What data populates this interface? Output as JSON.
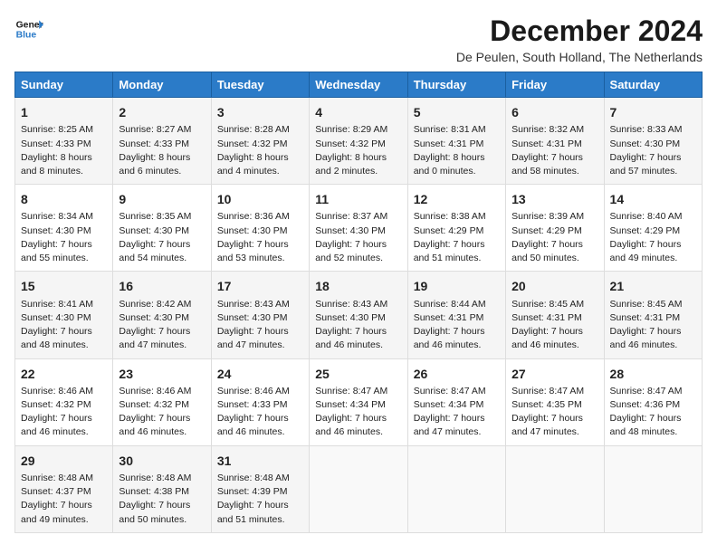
{
  "header": {
    "logo_line1": "General",
    "logo_line2": "Blue",
    "title": "December 2024",
    "subtitle": "De Peulen, South Holland, The Netherlands"
  },
  "columns": [
    "Sunday",
    "Monday",
    "Tuesday",
    "Wednesday",
    "Thursday",
    "Friday",
    "Saturday"
  ],
  "weeks": [
    [
      {
        "day": "1",
        "info": "Sunrise: 8:25 AM\nSunset: 4:33 PM\nDaylight: 8 hours\nand 8 minutes."
      },
      {
        "day": "2",
        "info": "Sunrise: 8:27 AM\nSunset: 4:33 PM\nDaylight: 8 hours\nand 6 minutes."
      },
      {
        "day": "3",
        "info": "Sunrise: 8:28 AM\nSunset: 4:32 PM\nDaylight: 8 hours\nand 4 minutes."
      },
      {
        "day": "4",
        "info": "Sunrise: 8:29 AM\nSunset: 4:32 PM\nDaylight: 8 hours\nand 2 minutes."
      },
      {
        "day": "5",
        "info": "Sunrise: 8:31 AM\nSunset: 4:31 PM\nDaylight: 8 hours\nand 0 minutes."
      },
      {
        "day": "6",
        "info": "Sunrise: 8:32 AM\nSunset: 4:31 PM\nDaylight: 7 hours\nand 58 minutes."
      },
      {
        "day": "7",
        "info": "Sunrise: 8:33 AM\nSunset: 4:30 PM\nDaylight: 7 hours\nand 57 minutes."
      }
    ],
    [
      {
        "day": "8",
        "info": "Sunrise: 8:34 AM\nSunset: 4:30 PM\nDaylight: 7 hours\nand 55 minutes."
      },
      {
        "day": "9",
        "info": "Sunrise: 8:35 AM\nSunset: 4:30 PM\nDaylight: 7 hours\nand 54 minutes."
      },
      {
        "day": "10",
        "info": "Sunrise: 8:36 AM\nSunset: 4:30 PM\nDaylight: 7 hours\nand 53 minutes."
      },
      {
        "day": "11",
        "info": "Sunrise: 8:37 AM\nSunset: 4:30 PM\nDaylight: 7 hours\nand 52 minutes."
      },
      {
        "day": "12",
        "info": "Sunrise: 8:38 AM\nSunset: 4:29 PM\nDaylight: 7 hours\nand 51 minutes."
      },
      {
        "day": "13",
        "info": "Sunrise: 8:39 AM\nSunset: 4:29 PM\nDaylight: 7 hours\nand 50 minutes."
      },
      {
        "day": "14",
        "info": "Sunrise: 8:40 AM\nSunset: 4:29 PM\nDaylight: 7 hours\nand 49 minutes."
      }
    ],
    [
      {
        "day": "15",
        "info": "Sunrise: 8:41 AM\nSunset: 4:30 PM\nDaylight: 7 hours\nand 48 minutes."
      },
      {
        "day": "16",
        "info": "Sunrise: 8:42 AM\nSunset: 4:30 PM\nDaylight: 7 hours\nand 47 minutes."
      },
      {
        "day": "17",
        "info": "Sunrise: 8:43 AM\nSunset: 4:30 PM\nDaylight: 7 hours\nand 47 minutes."
      },
      {
        "day": "18",
        "info": "Sunrise: 8:43 AM\nSunset: 4:30 PM\nDaylight: 7 hours\nand 46 minutes."
      },
      {
        "day": "19",
        "info": "Sunrise: 8:44 AM\nSunset: 4:31 PM\nDaylight: 7 hours\nand 46 minutes."
      },
      {
        "day": "20",
        "info": "Sunrise: 8:45 AM\nSunset: 4:31 PM\nDaylight: 7 hours\nand 46 minutes."
      },
      {
        "day": "21",
        "info": "Sunrise: 8:45 AM\nSunset: 4:31 PM\nDaylight: 7 hours\nand 46 minutes."
      }
    ],
    [
      {
        "day": "22",
        "info": "Sunrise: 8:46 AM\nSunset: 4:32 PM\nDaylight: 7 hours\nand 46 minutes."
      },
      {
        "day": "23",
        "info": "Sunrise: 8:46 AM\nSunset: 4:32 PM\nDaylight: 7 hours\nand 46 minutes."
      },
      {
        "day": "24",
        "info": "Sunrise: 8:46 AM\nSunset: 4:33 PM\nDaylight: 7 hours\nand 46 minutes."
      },
      {
        "day": "25",
        "info": "Sunrise: 8:47 AM\nSunset: 4:34 PM\nDaylight: 7 hours\nand 46 minutes."
      },
      {
        "day": "26",
        "info": "Sunrise: 8:47 AM\nSunset: 4:34 PM\nDaylight: 7 hours\nand 47 minutes."
      },
      {
        "day": "27",
        "info": "Sunrise: 8:47 AM\nSunset: 4:35 PM\nDaylight: 7 hours\nand 47 minutes."
      },
      {
        "day": "28",
        "info": "Sunrise: 8:47 AM\nSunset: 4:36 PM\nDaylight: 7 hours\nand 48 minutes."
      }
    ],
    [
      {
        "day": "29",
        "info": "Sunrise: 8:48 AM\nSunset: 4:37 PM\nDaylight: 7 hours\nand 49 minutes."
      },
      {
        "day": "30",
        "info": "Sunrise: 8:48 AM\nSunset: 4:38 PM\nDaylight: 7 hours\nand 50 minutes."
      },
      {
        "day": "31",
        "info": "Sunrise: 8:48 AM\nSunset: 4:39 PM\nDaylight: 7 hours\nand 51 minutes."
      },
      {
        "day": "",
        "info": ""
      },
      {
        "day": "",
        "info": ""
      },
      {
        "day": "",
        "info": ""
      },
      {
        "day": "",
        "info": ""
      }
    ]
  ]
}
